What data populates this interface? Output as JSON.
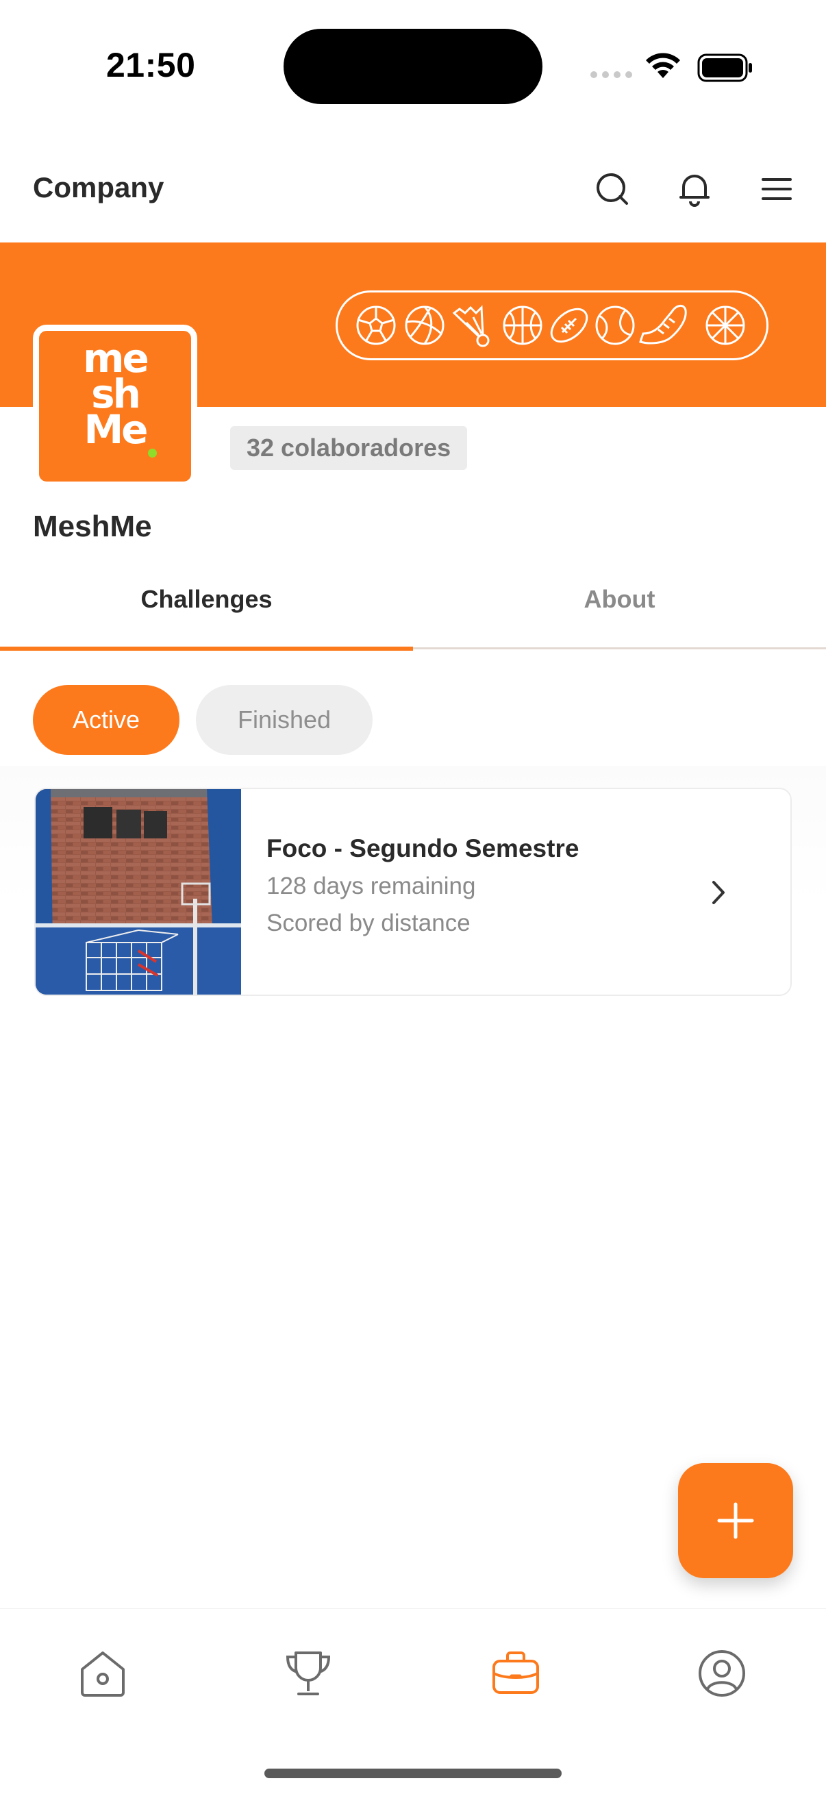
{
  "status_bar": {
    "time": "21:50"
  },
  "header": {
    "title": "Company",
    "icons": [
      "search-icon",
      "bell-icon",
      "menu-icon"
    ]
  },
  "company": {
    "logo_text": [
      "me",
      "sh",
      "Me"
    ],
    "members_label": "32 colaboradores",
    "name": "MeshMe",
    "sport_icons": [
      "soccer-ball-icon",
      "volleyball-icon",
      "shuttlecock-icon",
      "basketball-icon",
      "football-icon",
      "tennis-ball-icon",
      "sneaker-icon",
      "sport-ball-icon"
    ]
  },
  "tabs": [
    {
      "label": "Challenges",
      "active": true
    },
    {
      "label": "About",
      "active": false
    }
  ],
  "filters": [
    {
      "label": "Active",
      "selected": true
    },
    {
      "label": "Finished",
      "selected": false
    }
  ],
  "challenges": [
    {
      "title": "Foco - Segundo Semestre",
      "remaining": "128 days remaining",
      "scoring": "Scored by distance"
    }
  ],
  "fab": {
    "icon": "plus-icon"
  },
  "bottom_nav": [
    {
      "icon": "home-icon",
      "active": false
    },
    {
      "icon": "trophy-icon",
      "active": false
    },
    {
      "icon": "briefcase-icon",
      "active": true
    },
    {
      "icon": "profile-icon",
      "active": false
    }
  ],
  "colors": {
    "accent": "#fd7a1c",
    "text_primary": "#2a2a2a",
    "text_secondary": "#8a8a8a",
    "chip_inactive_bg": "#eeeeee",
    "logo_dot": "#8fdc2b"
  }
}
